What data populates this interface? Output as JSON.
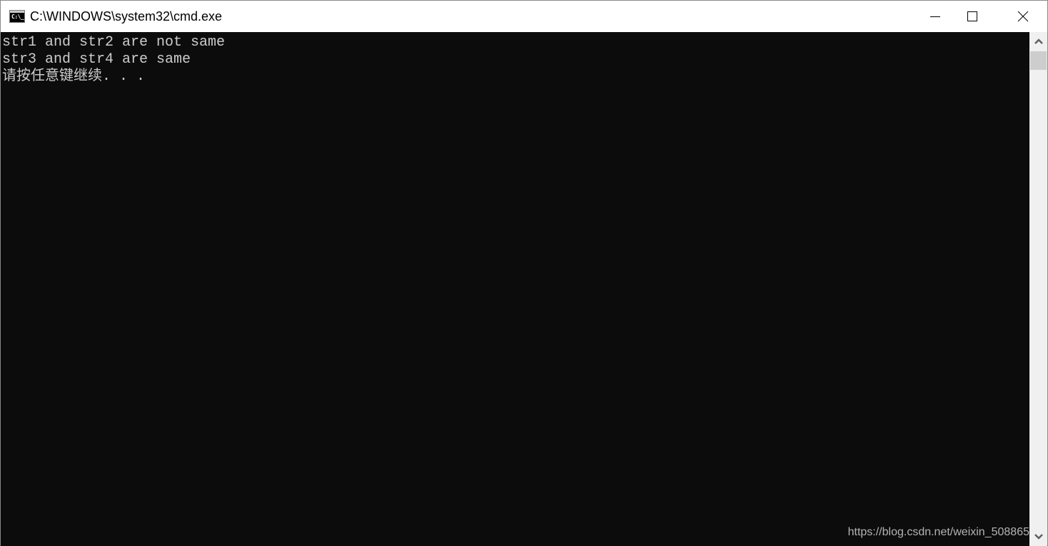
{
  "window": {
    "title": "C:\\WINDOWS\\system32\\cmd.exe",
    "icon": "cmd-icon",
    "icon_text": "C:\\_",
    "controls": {
      "minimize": "minimize-icon",
      "maximize": "maximize-icon",
      "close": "close-icon"
    }
  },
  "console": {
    "background": "#0c0c0c",
    "foreground": "#cccccc",
    "lines": [
      "str1 and str2 are not same",
      "str3 and str4 are same",
      "请按任意键继续. . ."
    ]
  },
  "watermark": "https://blog.csdn.net/weixin_508865",
  "scrollbar": {
    "up_icon": "chevron-up-icon",
    "down_icon": "chevron-down-icon",
    "position": 0
  }
}
